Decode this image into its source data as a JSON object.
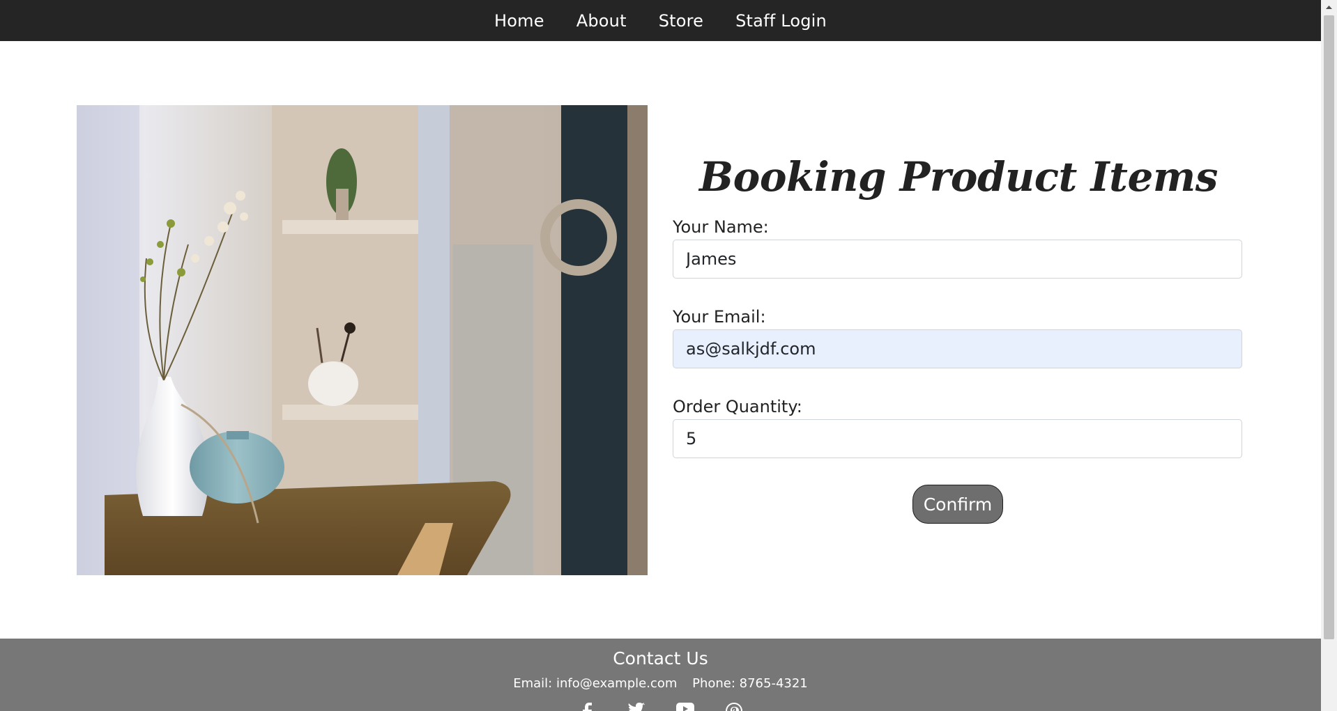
{
  "nav": {
    "items": [
      {
        "label": "Home"
      },
      {
        "label": "About"
      },
      {
        "label": "Store"
      },
      {
        "label": "Staff Login"
      }
    ]
  },
  "form": {
    "title": "Booking Product Items",
    "name": {
      "label": "Your Name:",
      "value": "James"
    },
    "email": {
      "label": "Your Email:",
      "value": "as@salkjdf.com"
    },
    "quantity": {
      "label": "Order Quantity:",
      "value": "5"
    },
    "confirm_label": "Confirm"
  },
  "footer": {
    "title": "Contact Us",
    "email": "Email: info@example.com",
    "phone": "Phone: 8765-4321",
    "social_icons": [
      "facebook-icon",
      "twitter-icon",
      "youtube-icon",
      "pinterest-icon"
    ]
  },
  "colors": {
    "nav_bg": "#252525",
    "footer_bg": "#777777",
    "button_bg": "#6e6e6e",
    "autofill_bg": "#e8f0fe"
  }
}
